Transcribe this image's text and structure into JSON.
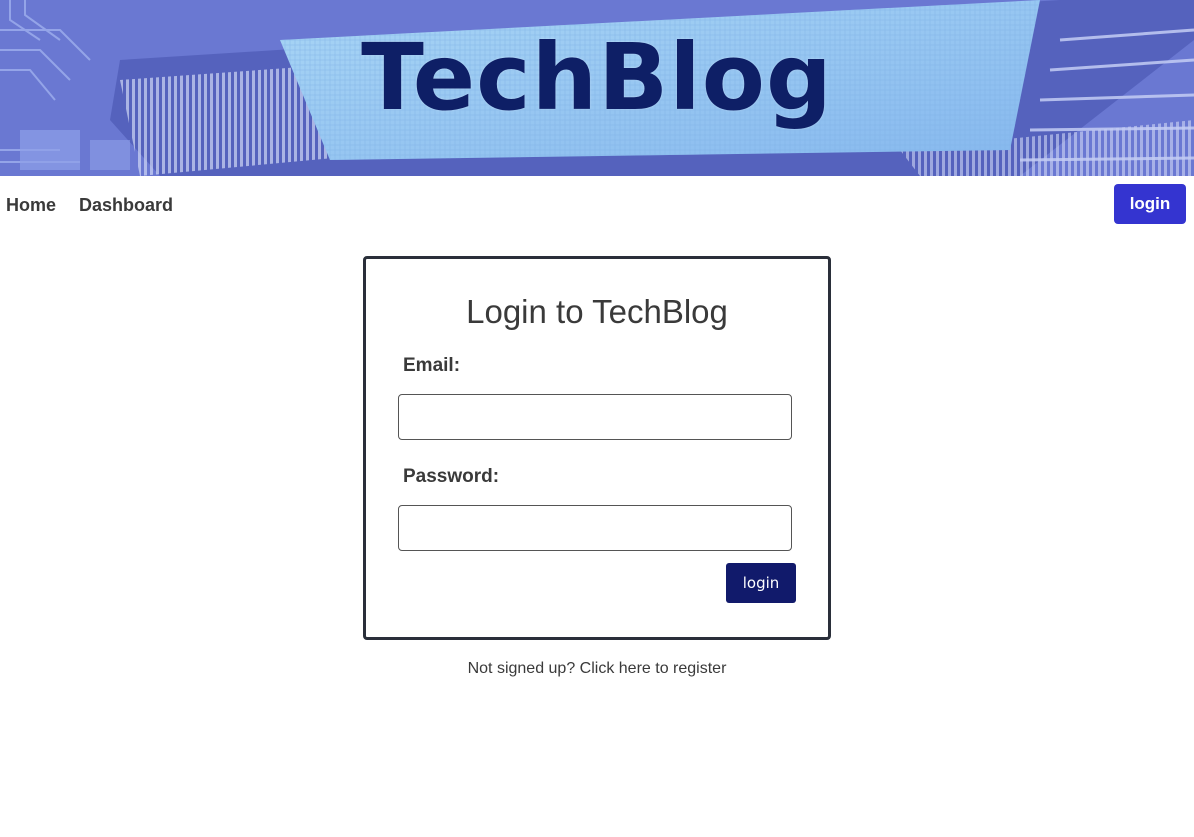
{
  "header": {
    "brand_title": "TechBlog"
  },
  "nav": {
    "home_label": "Home",
    "dashboard_label": "Dashboard",
    "login_label": "login"
  },
  "login_form": {
    "title": "Login to TechBlog",
    "email_label": "Email:",
    "email_value": "",
    "password_label": "Password:",
    "password_value": "",
    "submit_label": "login"
  },
  "register": {
    "link_text": "Not signed up? Click here to register"
  },
  "colors": {
    "nav_login_bg": "#3434d0",
    "submit_bg": "#111a6b",
    "brand_text": "#0e1f66",
    "card_border": "#2a2f3a"
  }
}
